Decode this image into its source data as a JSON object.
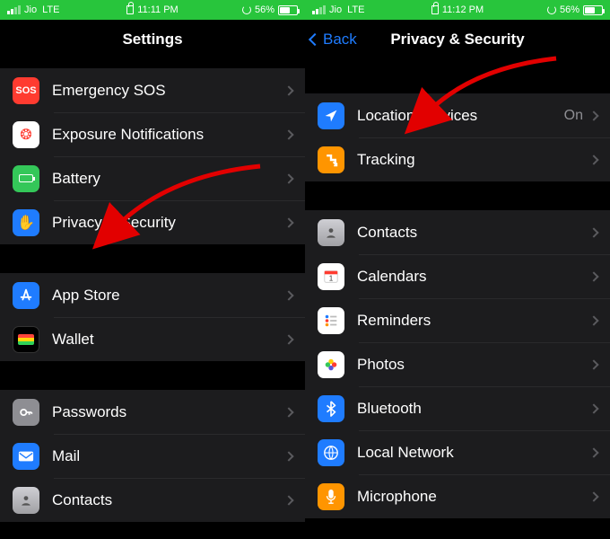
{
  "left": {
    "status": {
      "carrier": "Jio",
      "network": "LTE",
      "time": "11:11 PM",
      "battery": "56%"
    },
    "header": {
      "title": "Settings"
    },
    "groups": [
      [
        {
          "icon": "sos-icon",
          "color": "#ff3b30",
          "label": "Emergency SOS"
        },
        {
          "icon": "exposure-icon",
          "color": "#ffffff",
          "label": "Exposure Notifications"
        },
        {
          "icon": "battery-icon",
          "color": "#34c759",
          "label": "Battery"
        },
        {
          "icon": "hand-icon",
          "color": "#1f7cff",
          "label": "Privacy & Security"
        }
      ],
      [
        {
          "icon": "appstore-icon",
          "color": "#1f7cff",
          "label": "App Store"
        },
        {
          "icon": "wallet-icon",
          "color": "#000000",
          "label": "Wallet"
        }
      ],
      [
        {
          "icon": "key-icon",
          "color": "#8e8e93",
          "label": "Passwords"
        },
        {
          "icon": "mail-icon",
          "color": "#1f7cff",
          "label": "Mail"
        },
        {
          "icon": "contacts-icon",
          "color": "#a0a0a4",
          "label": "Contacts"
        }
      ]
    ]
  },
  "right": {
    "status": {
      "carrier": "Jio",
      "network": "LTE",
      "time": "11:12 PM",
      "battery": "56%"
    },
    "header": {
      "back": "Back",
      "title": "Privacy & Security"
    },
    "groups": [
      [
        {
          "icon": "location-icon",
          "color": "#1f7cff",
          "label": "Location Services",
          "detail": "On"
        },
        {
          "icon": "tracking-icon",
          "color": "#ff9500",
          "label": "Tracking"
        }
      ],
      [
        {
          "icon": "contacts-icon",
          "color": "#a0a0a4",
          "label": "Contacts"
        },
        {
          "icon": "calendar-icon",
          "color": "#ff3b30",
          "label": "Calendars"
        },
        {
          "icon": "reminders-icon",
          "color": "#ffffff",
          "label": "Reminders"
        },
        {
          "icon": "photos-icon",
          "color": "#ffffff",
          "label": "Photos"
        },
        {
          "icon": "bluetooth-icon",
          "color": "#1f7cff",
          "label": "Bluetooth"
        },
        {
          "icon": "network-icon",
          "color": "#1f7cff",
          "label": "Local Network"
        },
        {
          "icon": "microphone-icon",
          "color": "#ff9500",
          "label": "Microphone"
        }
      ]
    ]
  }
}
